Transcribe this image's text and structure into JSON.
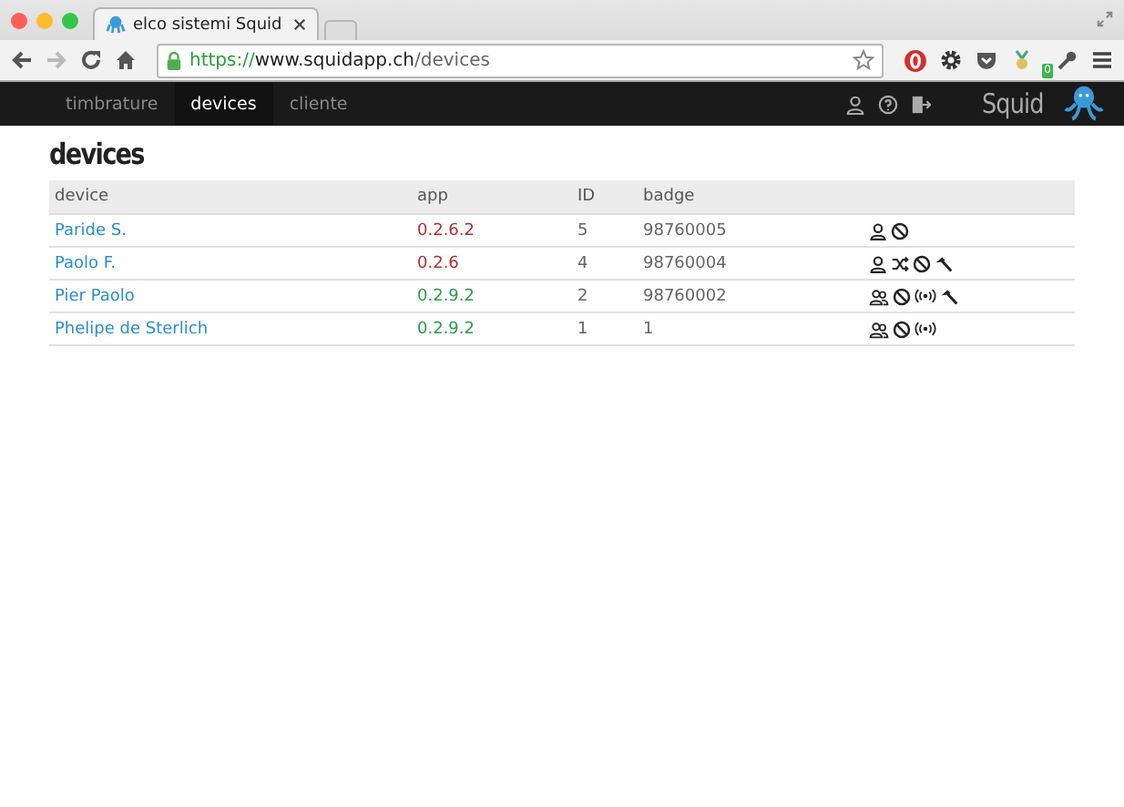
{
  "browser": {
    "tab_title": "elco sistemi Squid",
    "url_scheme": "https://",
    "url_host": "www.squidapp.ch",
    "url_path": "/devices",
    "badge_count": "0"
  },
  "nav": {
    "items": [
      {
        "label": "timbrature",
        "selected": false
      },
      {
        "label": "devices",
        "selected": true
      },
      {
        "label": "cliente",
        "selected": false
      }
    ],
    "logo": "Squid"
  },
  "page_title": "devices",
  "table": {
    "columns": [
      "device",
      "app",
      "ID",
      "badge"
    ],
    "rows": [
      {
        "device": "Paride S.",
        "app": "0.2.6.2",
        "outdated": true,
        "id": "5",
        "badge": "98760005",
        "icons": [
          {
            "kind": "user"
          },
          {
            "kind": "ban"
          }
        ]
      },
      {
        "device": "Paolo F.",
        "app": "0.2.6",
        "outdated": true,
        "id": "4",
        "badge": "98760004",
        "icons": [
          {
            "kind": "user"
          },
          {
            "kind": "shuffle"
          },
          {
            "kind": "ban"
          },
          {
            "kind": "hammer"
          }
        ]
      },
      {
        "device": "Pier Paolo",
        "app": "0.2.9.2",
        "outdated": false,
        "id": "2",
        "badge": "98760002",
        "icons": [
          {
            "kind": "users"
          },
          {
            "kind": "ban"
          },
          {
            "kind": "signal"
          },
          {
            "kind": "hammer"
          }
        ]
      },
      {
        "device": "Phelipe de Sterlich",
        "app": "0.2.9.2",
        "outdated": false,
        "id": "1",
        "badge": "1",
        "icons": [
          {
            "kind": "users"
          },
          {
            "kind": "ban"
          },
          {
            "kind": "signal"
          }
        ]
      }
    ]
  }
}
